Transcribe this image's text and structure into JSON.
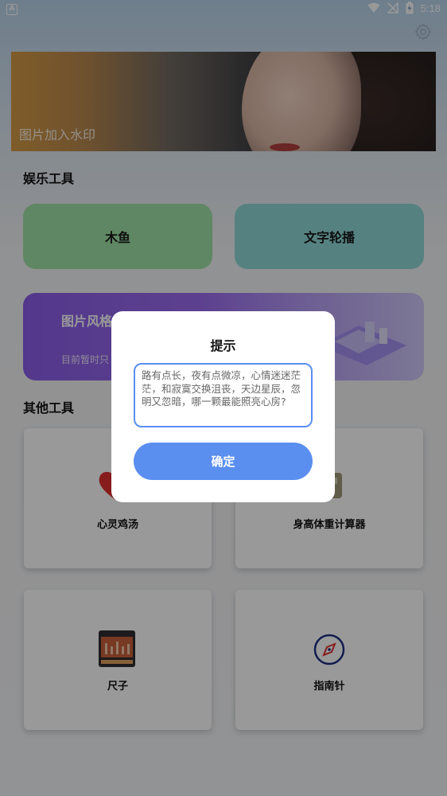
{
  "status_bar": {
    "app_icon": "A",
    "time": "5:18",
    "icons": [
      "wifi-icon",
      "signal-off-icon",
      "battery-charging-icon"
    ]
  },
  "banner": {
    "label": "图片加入水印"
  },
  "sections": {
    "entertainment": "娱乐工具",
    "other": "其他工具"
  },
  "entertainment_tools": {
    "muyu": "木鱼",
    "wenzi": "文字轮播"
  },
  "style_card": {
    "title": "图片风格",
    "subtitle": "目前暂时只"
  },
  "other_tools": {
    "soup": "心灵鸡汤",
    "bmi": "身高体重计算器",
    "ruler": "尺子",
    "compass": "指南针"
  },
  "dialog": {
    "title": "提示",
    "message": "路有点长，夜有点微凉，心情迷迷茫茫，和寂寞交换沮丧，天边星辰，忽明又忽暗，哪一颗最能照亮心房?",
    "confirm_label": "确定"
  },
  "colors": {
    "accent": "#5a8ff0",
    "muyu_bg": "#9fe2a6",
    "wenzi_bg": "#8fd8d8",
    "style_card_bg": "#8a5de8"
  }
}
